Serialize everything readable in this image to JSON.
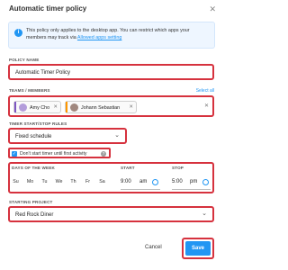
{
  "dialog": {
    "title": "Automatic timer policy",
    "close_glyph": "✕"
  },
  "info": {
    "icon_glyph": "i",
    "text": "This policy only applies to the desktop app. You can restrict which apps your members may track via",
    "link": "Allowed apps setting"
  },
  "policy_name": {
    "label": "POLICY NAME",
    "value": "Automatic Timer Policy"
  },
  "teams_members": {
    "label": "TEAMS / MEMBERS",
    "select_all": "Select all",
    "chips": [
      {
        "name": "Amy Cho",
        "color": "#7e57c2"
      },
      {
        "name": "Johann Sebastian",
        "color": "#ff9800"
      }
    ],
    "chip_remove_glyph": "✕",
    "clear_glyph": "✕"
  },
  "timer_rules": {
    "label": "TIMER START/STOP RULES",
    "value": "Fixed schedule",
    "chevron": "⌄"
  },
  "first_activity": {
    "label": "Don't start timer until first activity",
    "checked": true,
    "check_glyph": "✓",
    "help_glyph": "?"
  },
  "schedule": {
    "days_label": "DAYS OF THE WEEK",
    "days": [
      "Su",
      "Mo",
      "Tu",
      "We",
      "Th",
      "Fr",
      "Sa"
    ],
    "start_label": "START",
    "start_time": "9:00",
    "start_ampm": "am",
    "stop_label": "STOP",
    "stop_time": "5:00",
    "stop_ampm": "pm"
  },
  "starting_project": {
    "label": "STARTING PROJECT",
    "value": "Red Rock Diner",
    "chevron": "⌄"
  },
  "buttons": {
    "cancel": "Cancel",
    "save": "Save"
  },
  "colors": {
    "accent": "#2196f3",
    "highlight": "#d6323e"
  }
}
